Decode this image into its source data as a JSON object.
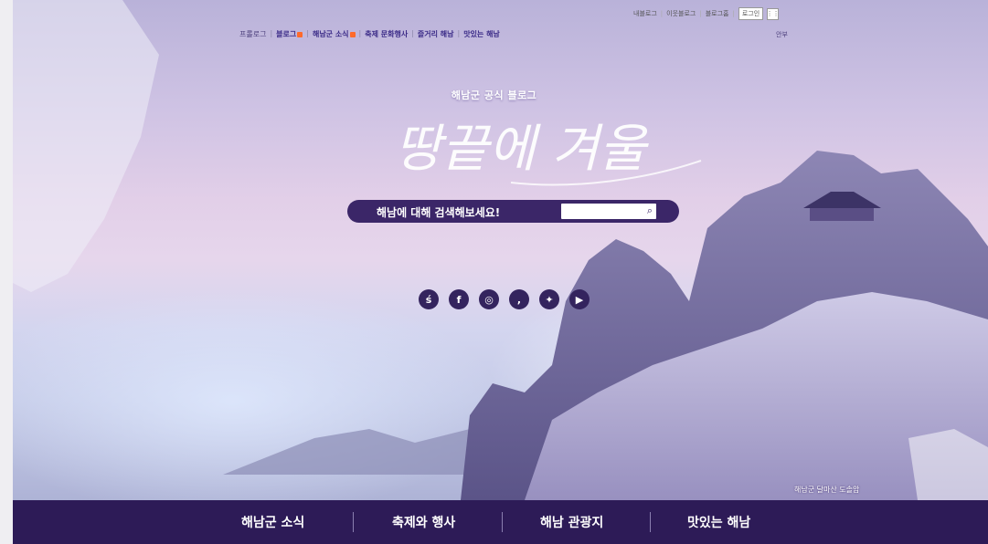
{
  "util_links": [
    "내블로그",
    "이웃블로그",
    "블로그홈"
  ],
  "login_label": "로그인",
  "apps_icon": "grid-icon",
  "top_nav": [
    {
      "label": "프롤로그"
    },
    {
      "label": "블로그",
      "badge": true
    },
    {
      "label": "해남군 소식",
      "badge": true
    },
    {
      "label": "축제 문화행사"
    },
    {
      "label": "즐거리 해남"
    },
    {
      "label": "맛있는 해남"
    }
  ],
  "intro_label": "안부",
  "hero": {
    "subtitle": "해남군 공식 블로그",
    "title": "땅끝에 겨울",
    "search_label": "해남에 대해 검색해보세요!",
    "search_placeholder": "",
    "caption": "해남군 달마산 도솔암"
  },
  "social_icons": [
    "blog-icon",
    "facebook-icon",
    "instagram-icon",
    "post-icon",
    "twitter-icon",
    "youtube-icon"
  ],
  "main_nav": [
    "해남군 소식",
    "축제와 행사",
    "해남 관광지",
    "맛있는 해남"
  ],
  "colors": {
    "accent": "#2d1b57",
    "search_bar": "#3b2668",
    "badge": "#ff6a2b"
  }
}
